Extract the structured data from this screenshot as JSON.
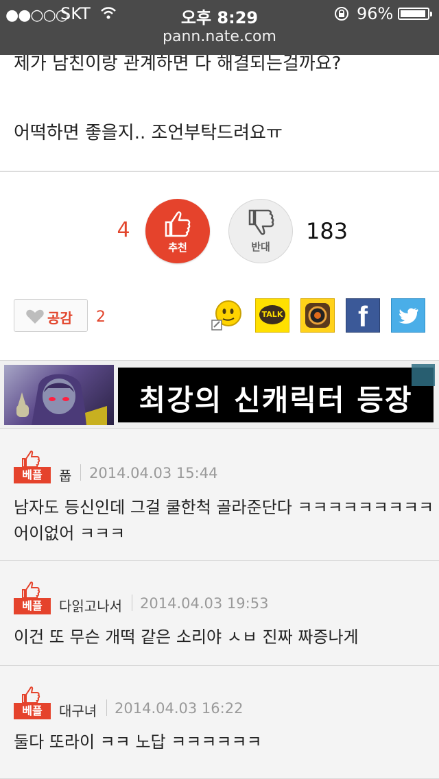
{
  "status_bar": {
    "signal": "●●○○○",
    "carrier": "SKT",
    "time": "오후 8:29",
    "battery_percent": "96%",
    "battery_level": 0.96,
    "url": "pann.nate.com"
  },
  "post": {
    "body_line1": "제가 남친이랑 관계하면 다 해결되는걸까요?",
    "body_line2": "어떡하면 좋을지.. 조언부탁드려요ㅠ"
  },
  "votes": {
    "up_count": "4",
    "up_label": "추천",
    "down_label": "반대",
    "down_count": "183"
  },
  "empathy": {
    "label": "공감",
    "count": "2"
  },
  "share": {
    "kakao_label": "TALK",
    "facebook_label": "f"
  },
  "ad": {
    "text": "최강의 신캐릭터 등장"
  },
  "comments": [
    {
      "badge": "베플",
      "author": "풉",
      "date": "2014.04.03 15:44",
      "lines": [
        "남자도 등신인데 그걸 쿨한척 골라준단다 ㅋㅋㅋㅋㅋㅋㅋㅋㅋ",
        "어이없어 ㅋㅋㅋ"
      ]
    },
    {
      "badge": "베플",
      "author": "다읽고나서",
      "date": "2014.04.03 19:53",
      "lines": [
        "이건 또 무슨 개떡 같은 소리야 ㅅㅂ 진짜 짜증나게"
      ]
    },
    {
      "badge": "베플",
      "author": "대구녀",
      "date": "2014.04.03 16:22",
      "lines": [
        "둘다 또라이 ㅋㅋ 노답 ㅋㅋㅋㅋㅋㅋ"
      ]
    }
  ],
  "colors": {
    "accent_red": "#e5432c",
    "status_bar_bg": "#4a4a4a",
    "comment_bg": "#f4f4f4"
  }
}
